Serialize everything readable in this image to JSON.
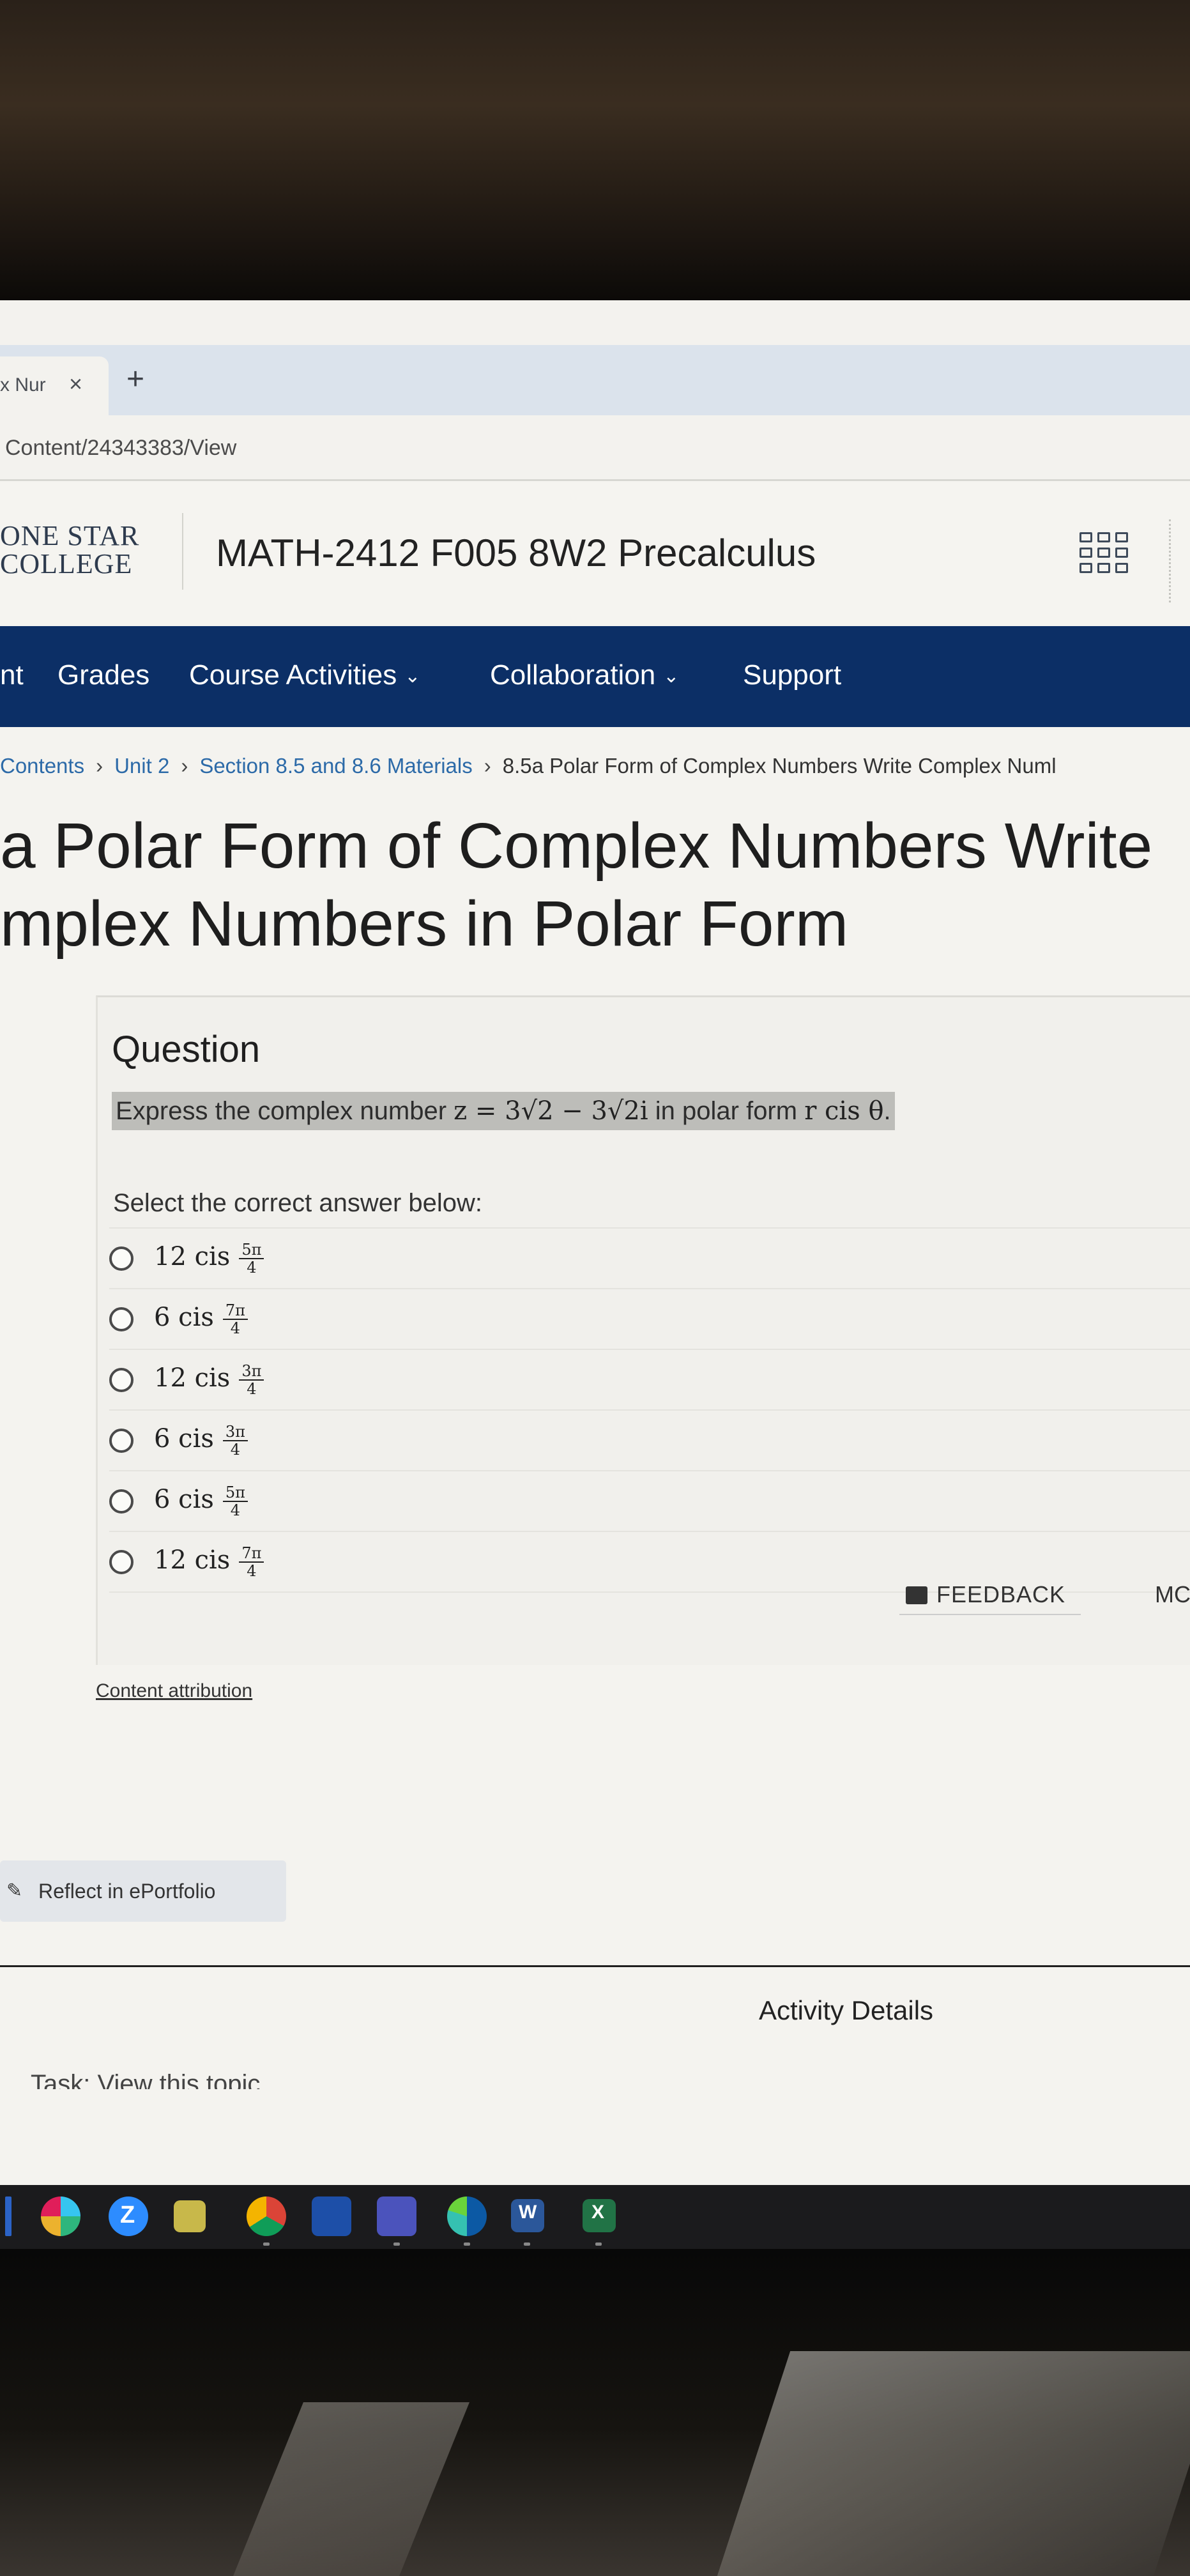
{
  "browser": {
    "tab_title": "x Nur",
    "tab_close": "×",
    "new_tab": "+",
    "address": "Content/24343383/View"
  },
  "header": {
    "logo_line1": "ONE STAR",
    "logo_line2": "COLLEGE",
    "course_title": "MATH-2412 F005 8W2 Precalculus",
    "apps_icon": "grid-icon"
  },
  "nav": {
    "items": [
      {
        "label": "nt",
        "has_dropdown": false
      },
      {
        "label": "Grades",
        "has_dropdown": false
      },
      {
        "label": "Course Activities",
        "has_dropdown": true
      },
      {
        "label": "Collaboration",
        "has_dropdown": true
      },
      {
        "label": "Support",
        "has_dropdown": false
      }
    ],
    "dropdown_glyph": "⌄"
  },
  "breadcrumb": {
    "items": [
      "Contents",
      "Unit 2",
      "Section 8.5 and 8.6 Materials"
    ],
    "current": "8.5a Polar Form of Complex Numbers Write Complex Numl",
    "separator": "›"
  },
  "page_title": {
    "line1": "a Polar Form of Complex Numbers Write",
    "line2": "mplex Numbers in Polar Form"
  },
  "question": {
    "heading": "Question",
    "prompt_prefix": "Express the complex number ",
    "prompt_math": "z = 3√2 − 3√2i",
    "prompt_middle": " in polar form ",
    "prompt_math2": "r cis θ",
    "prompt_suffix": ".",
    "instruction": "Select the correct answer below:",
    "answers": [
      {
        "coef": "12 cis",
        "num": "5π",
        "den": "4"
      },
      {
        "coef": "6 cis",
        "num": "7π",
        "den": "4"
      },
      {
        "coef": "12 cis",
        "num": "3π",
        "den": "4"
      },
      {
        "coef": "6 cis",
        "num": "3π",
        "den": "4"
      },
      {
        "coef": "6 cis",
        "num": "5π",
        "den": "4"
      },
      {
        "coef": "12 cis",
        "num": "7π",
        "den": "4"
      }
    ],
    "feedback_label": "FEEDBACK",
    "more_label": "MC"
  },
  "content_attribution": "Content attribution",
  "reflect_label": "Reflect in ePortfolio",
  "activity_details": "Activity Details",
  "task_text": "Task: View this topic",
  "taskbar": {
    "icons": [
      "slack-icon",
      "zoom-icon",
      "snipping-icon",
      "chrome-icon",
      "webex-icon",
      "teams-icon",
      "edge-icon",
      "word-icon",
      "excel-icon"
    ],
    "zoom_letter": "Z",
    "word_letter": "W",
    "excel_letter": "X"
  },
  "colors": {
    "navbar": "#0c2f66",
    "link": "#2c6aa8",
    "prompt_highlight": "#bdbdb9"
  }
}
